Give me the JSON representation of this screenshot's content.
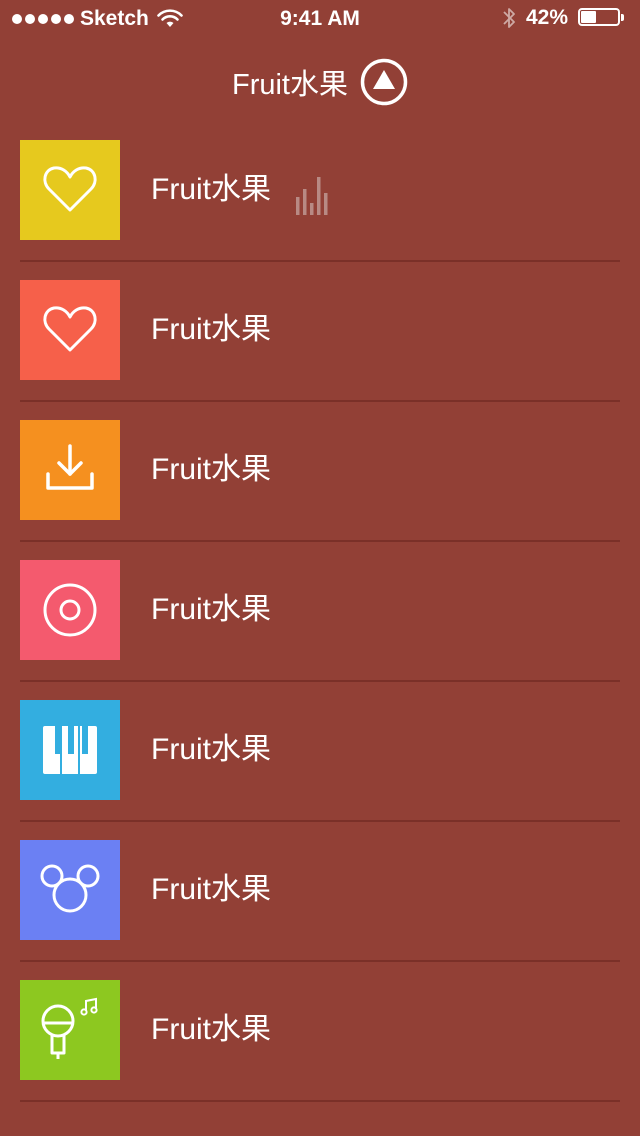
{
  "status_bar": {
    "carrier": "Sketch",
    "time": "9:41 AM",
    "battery_percent": "42%",
    "battery_level": 0.42,
    "signal_dots": 5
  },
  "header": {
    "title": "Fruit水果",
    "icon": "triangle-circle-icon"
  },
  "colors": {
    "background": "#924036",
    "divider": "#7a3028"
  },
  "list": {
    "items": [
      {
        "label": "Fruit水果",
        "icon": "heart-icon",
        "color": "#e6c91e",
        "now_playing": true
      },
      {
        "label": "Fruit水果",
        "icon": "heart-icon",
        "color": "#f6604a",
        "now_playing": false
      },
      {
        "label": "Fruit水果",
        "icon": "download-icon",
        "color": "#f5901f",
        "now_playing": false
      },
      {
        "label": "Fruit水果",
        "icon": "disc-icon",
        "color": "#f45a6e",
        "now_playing": false
      },
      {
        "label": "Fruit水果",
        "icon": "piano-icon",
        "color": "#33aee0",
        "now_playing": false
      },
      {
        "label": "Fruit水果",
        "icon": "mickey-icon",
        "color": "#6b80f3",
        "now_playing": false
      },
      {
        "label": "Fruit水果",
        "icon": "microphone-icon",
        "color": "#8dc820",
        "now_playing": false
      }
    ]
  }
}
